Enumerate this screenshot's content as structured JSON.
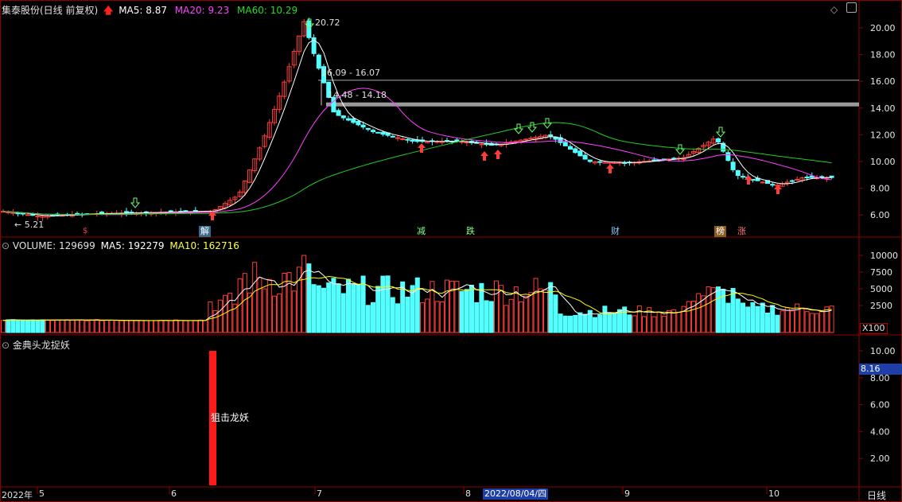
{
  "header": {
    "stock_name": "集泰股份(日线 前复权)",
    "ma5": "MA5: 8.87",
    "ma20": "MA20: 9.23",
    "ma60": "MA60: 10.29"
  },
  "volume_header": {
    "volume": "VOLUME: 129699",
    "ma5": "MA5: 192279",
    "ma10": "MA10: 162716"
  },
  "indicator_header": {
    "title": "金典头龙捉妖"
  },
  "annotations": {
    "high_label": "20.72",
    "low_label": "5.21",
    "range1": "16.09 - 16.07",
    "range2": "14.48 - 14.18",
    "indicator_bar_label": "狙击龙妖",
    "volume_scale": "X100",
    "current_value": "8.16"
  },
  "badges": [
    "解",
    "减",
    "跌",
    "财",
    "榜",
    "涨",
    "$"
  ],
  "price_axis": [
    "20.00",
    "18.00",
    "16.00",
    "14.00",
    "12.00",
    "10.00",
    "8.00",
    "6.00"
  ],
  "volume_axis": [
    "10000",
    "7500",
    "5000",
    "2500"
  ],
  "indicator_axis": [
    "10.00",
    "8.00",
    "6.00",
    "4.00",
    "2.00"
  ],
  "date_axis": {
    "year": "2022年",
    "months": [
      "5",
      "6",
      "7",
      "8",
      "9",
      "10"
    ],
    "cursor_date": "2022/08/04/四",
    "period": "日线"
  },
  "colors": {
    "up": "#ff3c3c",
    "down": "#54ffff",
    "ma5": "#ffffff",
    "ma20": "#ff40ff",
    "ma60": "#22cc22",
    "vol_ma5": "#ffffff",
    "vol_ma10": "#ffff00",
    "grid": "#8b0000"
  }
}
